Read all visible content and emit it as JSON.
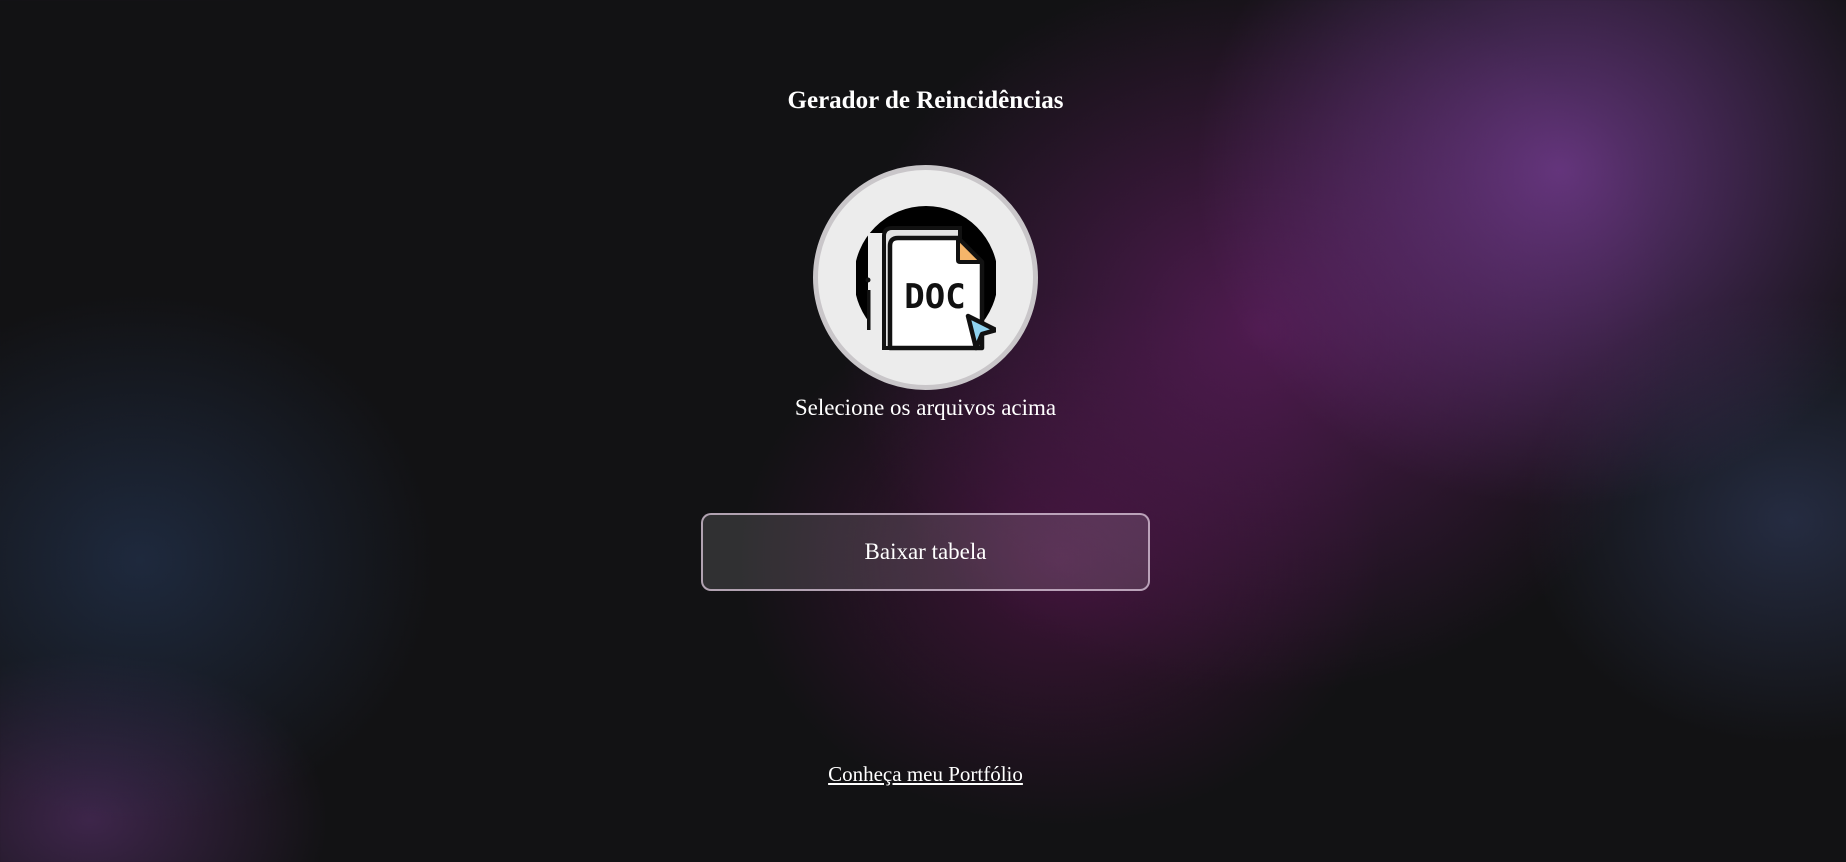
{
  "page": {
    "title": "Gerador de Reincidências"
  },
  "upload": {
    "icon": "doc-file-cursor-icon",
    "icon_label": "DOC",
    "hint": "Selecione os arquivos acima"
  },
  "actions": {
    "download_label": "Baixar tabela"
  },
  "footer": {
    "portfolio_link": "Conheça meu Portfólio"
  },
  "colors": {
    "background": "#121214",
    "accent_purple": "#7a3e96",
    "text": "#ffffff",
    "circle_fill": "#ececec",
    "circle_border": "#c9c6c9",
    "doc_corner": "#f5b56a",
    "cursor": "#8fd3f0"
  }
}
